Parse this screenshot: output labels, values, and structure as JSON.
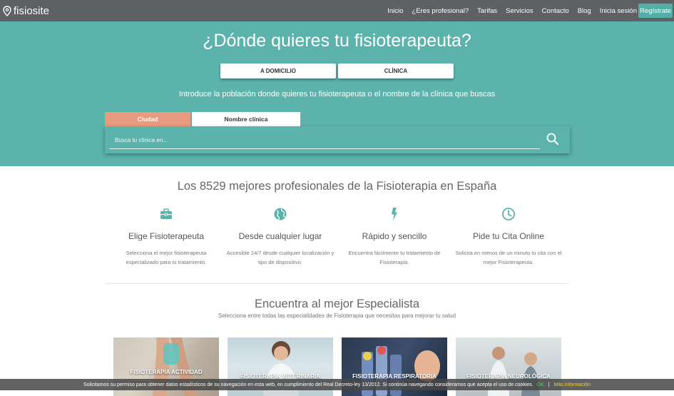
{
  "navbar": {
    "brand": "fisiosite",
    "links": [
      "Inicio",
      "¿Eres profesional?",
      "Tarifas",
      "Servicios",
      "Contacto",
      "Blog",
      "Inicia sesión"
    ],
    "register_label": "Regístrate"
  },
  "hero": {
    "title": "¿Dónde quieres tu fisioterapeuta?",
    "mode_home": "A DOMICILIO",
    "mode_clinic": "CLÍNICA",
    "subtitle": "Introduce la población donde quieres tu fisioterapeuta o el nombre de la clínica que buscas",
    "tab_city": "Ciudad",
    "tab_clinic_name": "Nombre clínica",
    "search_placeholder": "Busca tu clínica en..."
  },
  "features": {
    "title": "Los 8529 mejores profesionales de la Fisioterapia en España",
    "items": [
      {
        "icon": "briefcase-icon",
        "name": "Elige Fisioterapeuta",
        "desc": "Selecciona el mejor fisioterapeuta especializado para tu tratamiento."
      },
      {
        "icon": "globe-icon",
        "name": "Desde cualquier lugar",
        "desc": "Accesible 24/7 desde cualquier localización y tipo de dispositivo."
      },
      {
        "icon": "lightning-icon",
        "name": "Rápido y sencillo",
        "desc": "Encuentra fácilmente tu tratamiento de Fisioterapia."
      },
      {
        "icon": "clock-icon",
        "name": "Pide tu Cita Online",
        "desc": "Solicita en menos de un minuto tu cita con el mejor Fisioterapeuta."
      }
    ]
  },
  "specialists": {
    "title": "Encuentra al mejor Especialista",
    "subtitle": "Selecciona entre todas las especialidades de Fisioterapia que necesitas para mejorar tu salud",
    "cards": [
      {
        "label": "FISIOTERAPIA ACTIVIDAD"
      },
      {
        "label": "FISIOTERAPIA VETERINARIA"
      },
      {
        "label": "FISIOTERAPIA RESPIRATORIA"
      },
      {
        "label": "FISIOTERAPIA NEUROLÓGICA"
      }
    ]
  },
  "cookie": {
    "text": "Solicitamos su permiso para obtener datos estadísticos de su navegación en esta web, en cumplimiento del Real Decreto-ley 13/2012. Si continúa navegando consideramos que acepta el uso de cookies.",
    "ok": "OK",
    "separator": "|",
    "more": "Más información"
  },
  "colors": {
    "navbar": "#5d6163",
    "teal": "#5bb3ac",
    "accent_tab": "#e99b7f",
    "register": "#54aea6"
  }
}
